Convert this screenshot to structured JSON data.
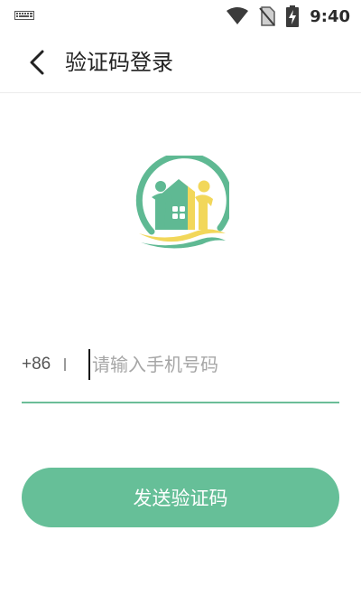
{
  "status_bar": {
    "time": "9:40",
    "icons": [
      "keyboard-icon",
      "wifi-icon",
      "no-sim-icon",
      "battery-charging-icon"
    ]
  },
  "header": {
    "back_icon": "chevron-left-icon",
    "title": "验证码登录"
  },
  "logo": {
    "icon": "house-family-logo",
    "colors": {
      "green": "#5fb993",
      "yellow": "#f2d75a"
    }
  },
  "login_form": {
    "country_code": "+86",
    "phone_placeholder": "请输入手机号码",
    "phone_value": ""
  },
  "send_button": {
    "label": "发送验证码",
    "color": "#66bf98"
  }
}
